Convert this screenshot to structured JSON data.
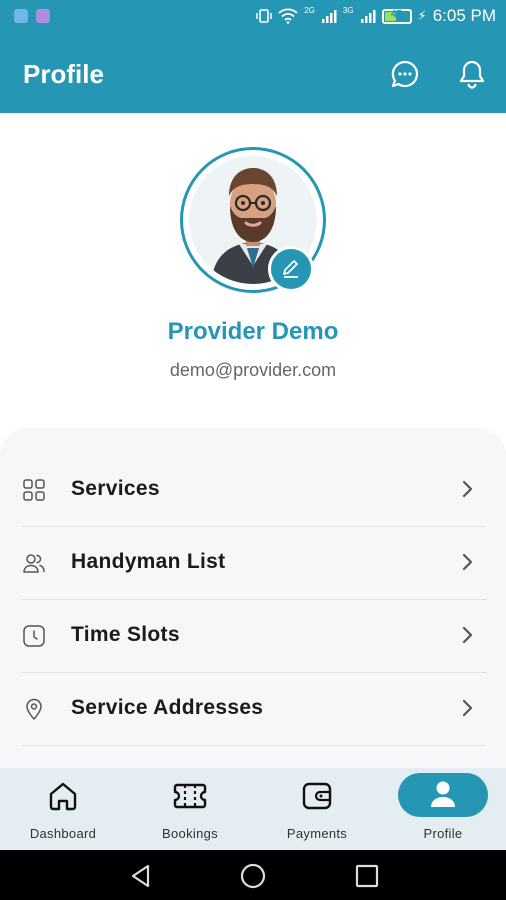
{
  "status_bar": {
    "time": "6:05 PM",
    "battery_level": "45",
    "network_1": "2G",
    "network_2": "3G"
  },
  "app_bar": {
    "title": "Profile",
    "icons": [
      "chat-icon",
      "bell-icon"
    ]
  },
  "profile": {
    "name": "Provider Demo",
    "email": "demo@provider.com",
    "avatar": "avatar-image",
    "edit_icon": "edit-icon"
  },
  "menu": {
    "items": [
      {
        "label": "Services",
        "icon": "grid-icon"
      },
      {
        "label": "Handyman List",
        "icon": "users-icon"
      },
      {
        "label": "Time Slots",
        "icon": "clock-icon"
      },
      {
        "label": "Service Addresses",
        "icon": "location-pin-icon"
      }
    ]
  },
  "bottom_nav": {
    "items": [
      {
        "label": "Dashboard",
        "icon": "home-icon"
      },
      {
        "label": "Bookings",
        "icon": "ticket-icon"
      },
      {
        "label": "Payments",
        "icon": "wallet-icon"
      },
      {
        "label": "Profile",
        "icon": "person-icon",
        "active": true
      }
    ]
  },
  "colors": {
    "primary": "#2596b3",
    "background": "#ffffff",
    "card": "#f7f7f9",
    "nav_background": "#e4edf1"
  }
}
